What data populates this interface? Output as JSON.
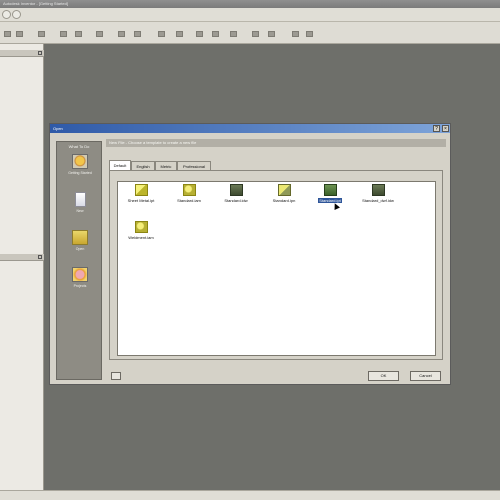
{
  "window": {
    "title": "Autodesk Inventor - [Getting Started]"
  },
  "dialog": {
    "title": "Open",
    "what_to_do": "What To Do",
    "side_buttons": [
      {
        "label": "Getting Started",
        "icon": "getting-started-icon"
      },
      {
        "label": "New",
        "icon": "new-file-icon"
      },
      {
        "label": "Open",
        "icon": "open-folder-icon"
      },
      {
        "label": "Projects",
        "icon": "projects-icon"
      }
    ],
    "new_file_caption": "New File - Choose a template to create a new file",
    "tabs": [
      "Default",
      "English",
      "Metric",
      "Professional"
    ],
    "files": [
      {
        "label": "Sheet Metal.ipt",
        "icon": "sheet-metal-part-icon"
      },
      {
        "label": "Standard.iam",
        "icon": "assembly-file-icon"
      },
      {
        "label": "Standard.idw",
        "icon": "drawing-file-icon"
      },
      {
        "label": "Standard.ipn",
        "icon": "presentation-file-icon"
      },
      {
        "label": "Standard.ipt",
        "icon": "part-file-icon"
      },
      {
        "label": "Standard_dwf.idw",
        "icon": "dwf-drawing-file-icon"
      },
      {
        "label": "Weldment.iam",
        "icon": "weldment-file-icon"
      }
    ],
    "ok_label": "OK",
    "cancel_label": "Cancel",
    "help_glyph": "?",
    "close_glyph": "×"
  }
}
